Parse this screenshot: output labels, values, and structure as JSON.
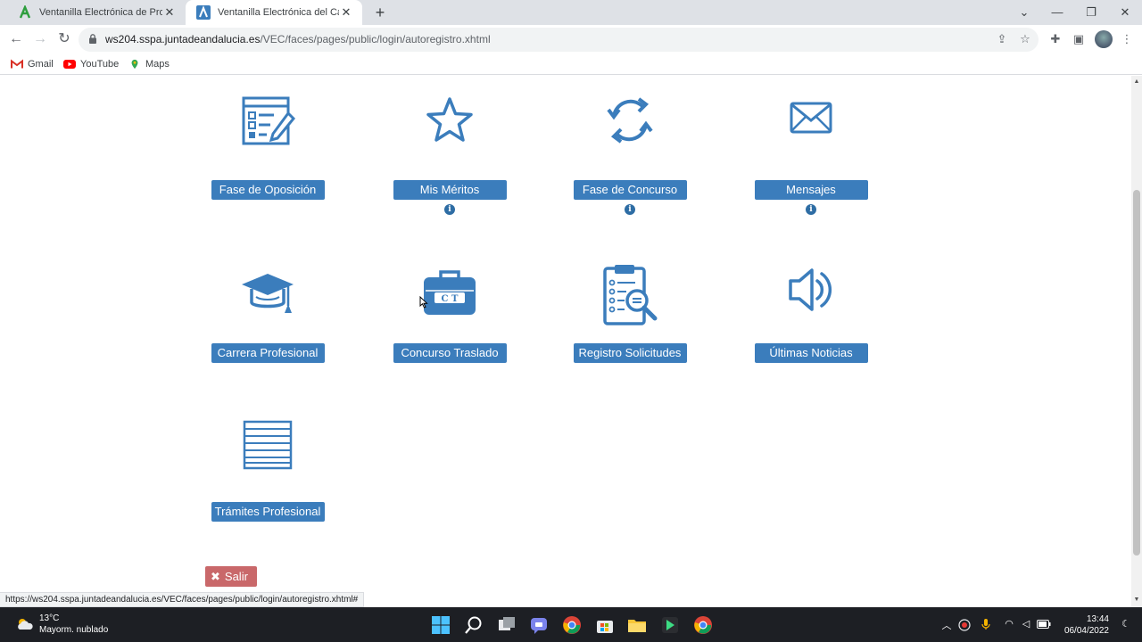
{
  "browser": {
    "tabs": [
      {
        "title": "Ventanilla Electrónica de Profesio",
        "favicon": "green-a-logo",
        "active": false
      },
      {
        "title": "Ventanilla Electrónica del Candid",
        "favicon": "junta-andalucia-logo",
        "active": true
      }
    ],
    "new_tab": "+",
    "window_controls": {
      "dropdown": "⌄",
      "minimize": "—",
      "restore": "❐",
      "close": "✕"
    },
    "url_host": "ws204.sspa.juntadeandalucia.es",
    "url_path": "/VEC/faces/pages/public/login/autoregistro.xhtml",
    "bookmarks": [
      {
        "label": "Gmail",
        "icon": "gmail-icon"
      },
      {
        "label": "YouTube",
        "icon": "youtube-icon"
      },
      {
        "label": "Maps",
        "icon": "maps-icon"
      }
    ]
  },
  "page": {
    "accent": "#3b7dbc",
    "tiles": [
      {
        "label": "Fase de Oposición",
        "icon": "checklist-form-icon",
        "info": false
      },
      {
        "label": "Mis Méritos",
        "icon": "star-icon",
        "info": true
      },
      {
        "label": "Fase de Concurso",
        "icon": "refresh-cycle-icon",
        "info": true
      },
      {
        "label": "Mensajes",
        "icon": "envelope-icon",
        "info": true
      },
      {
        "label": "Carrera Profesional",
        "icon": "graduation-cap-icon",
        "info": false
      },
      {
        "label": "Concurso Traslado",
        "icon": "briefcase-icon",
        "info": false
      },
      {
        "label": "Registro Solicitudes",
        "icon": "clipboard-search-icon",
        "info": false
      },
      {
        "label": "Últimas Noticias",
        "icon": "speaker-icon",
        "info": false
      },
      {
        "label": "Trámites Profesional",
        "icon": "list-document-icon",
        "info": false
      }
    ],
    "info_glyph": "i",
    "logout_icon": "✖",
    "logout_label": "Salir",
    "logout_color": "#c9686a"
  },
  "status_bar_url": "https://ws204.sspa.juntadeandalucia.es/VEC/faces/pages/public/login/autoregistro.xhtml#",
  "taskbar": {
    "weather_temp": "13°C",
    "weather_desc": "Mayorm. nublado",
    "time": "13:44",
    "date": "06/04/2022"
  }
}
